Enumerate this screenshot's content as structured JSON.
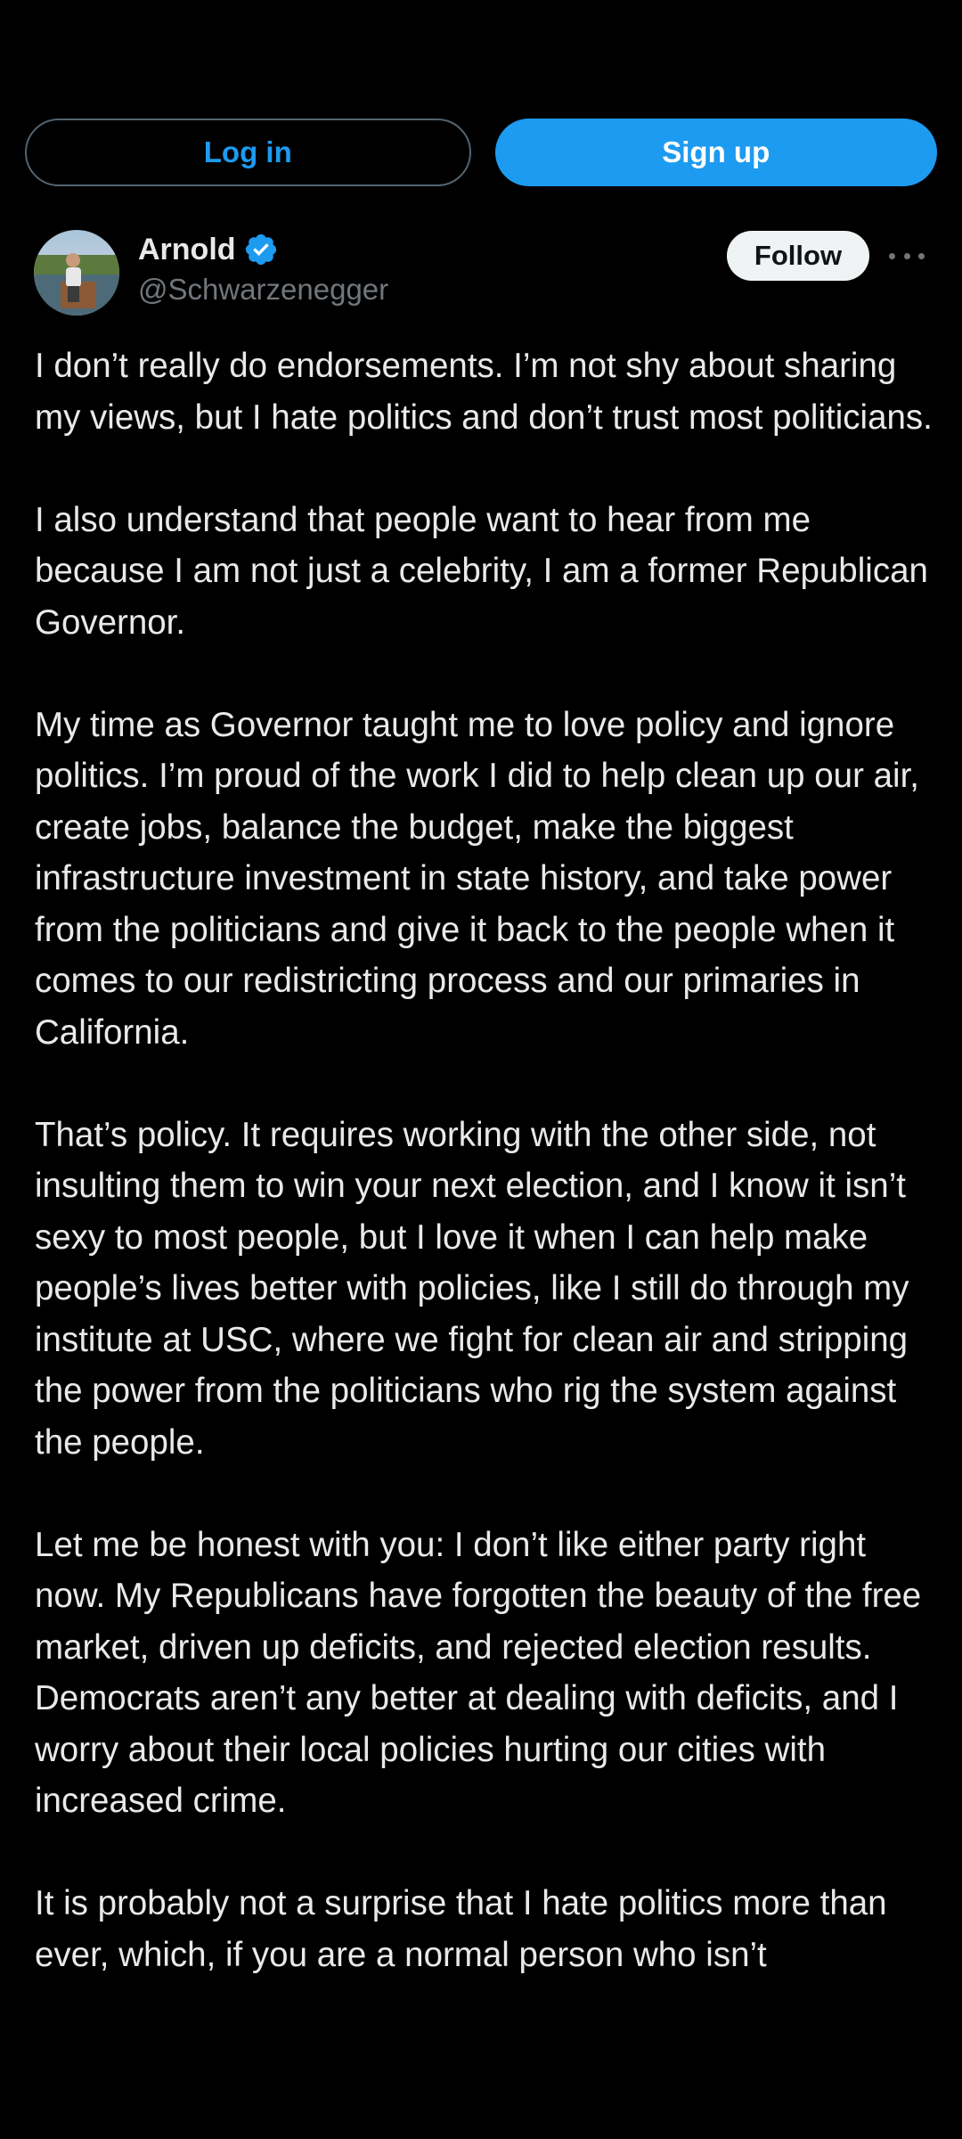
{
  "auth": {
    "login_label": "Log in",
    "signup_label": "Sign up"
  },
  "author": {
    "display_name": "Arnold",
    "handle": "@Schwarzenegger",
    "verified": true,
    "follow_label": "Follow"
  },
  "tweet": {
    "paragraphs": [
      "I don’t really do endorsements. I’m not shy about sharing my views, but I hate politics and don’t trust most politicians.",
      "I also understand that people want to hear from me because I am not just a celebrity, I am a former Republican Governor.",
      "My time as Governor taught me to love policy and ignore politics. I’m proud of the work I did to help clean up our air, create jobs, balance the budget, make the biggest infrastructure investment in state history, and take power from the politicians and give it back to the people when it comes to our redistricting process and our primaries in California.",
      "That’s policy. It requires working with the other side, not insulting them to win your next election, and I know it isn’t sexy to most people, but I love it when I can help make people’s lives better with policies, like I still do through my institute at USC, where we fight for clean air and stripping the power from the politicians who rig the system against the people.",
      "Let me be honest with you: I don’t like either party right now. My Republicans have forgotten the beauty of the free market, driven up deficits, and rejected election results. Democrats aren’t any better at dealing with deficits, and I worry about their local policies hurting our cities with increased crime.",
      "It is probably not a surprise that I hate politics more than ever, which, if you are a normal person who isn’t"
    ]
  },
  "icons": {
    "verified": "verified-badge-icon",
    "more": "more-options-icon"
  },
  "colors": {
    "background": "#000000",
    "accent": "#1d9bf0",
    "text_primary": "#e7e9ea",
    "text_secondary": "#71767b"
  }
}
